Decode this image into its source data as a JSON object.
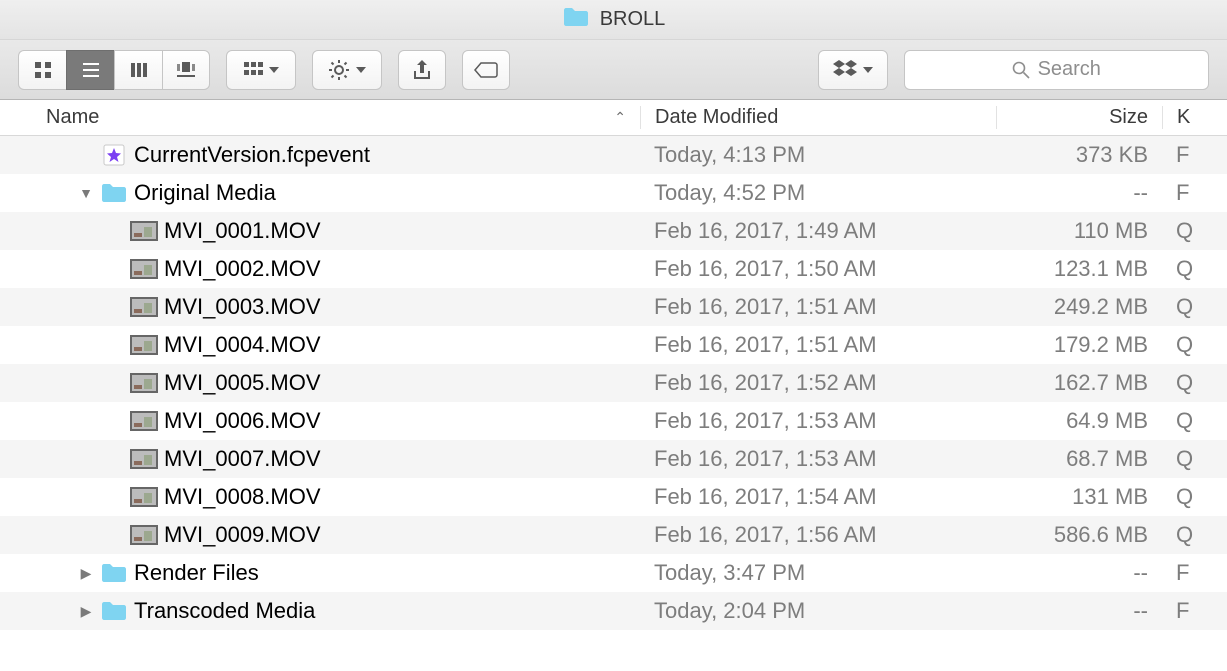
{
  "window": {
    "title": "BROLL"
  },
  "toolbar": {
    "search_placeholder": "Search",
    "view_modes": [
      "icon",
      "list",
      "column",
      "coverflow"
    ],
    "active_view_mode": "list"
  },
  "columns": {
    "name": "Name",
    "date": "Date Modified",
    "size": "Size",
    "kind": "K",
    "sort_column": "name",
    "sort_dir": "asc"
  },
  "rows": [
    {
      "indent": 1,
      "disclosure": "none",
      "icon": "fcp",
      "name": "CurrentVersion.fcpevent",
      "date": "Today, 4:13 PM",
      "size": "373 KB",
      "kind": "F"
    },
    {
      "indent": 1,
      "disclosure": "open",
      "icon": "folder",
      "name": "Original Media",
      "date": "Today, 4:52 PM",
      "size": "--",
      "kind": "F"
    },
    {
      "indent": 2,
      "disclosure": "none",
      "icon": "movie",
      "name": "MVI_0001.MOV",
      "date": "Feb 16, 2017, 1:49 AM",
      "size": "110 MB",
      "kind": "Q"
    },
    {
      "indent": 2,
      "disclosure": "none",
      "icon": "movie",
      "name": "MVI_0002.MOV",
      "date": "Feb 16, 2017, 1:50 AM",
      "size": "123.1 MB",
      "kind": "Q"
    },
    {
      "indent": 2,
      "disclosure": "none",
      "icon": "movie",
      "name": "MVI_0003.MOV",
      "date": "Feb 16, 2017, 1:51 AM",
      "size": "249.2 MB",
      "kind": "Q"
    },
    {
      "indent": 2,
      "disclosure": "none",
      "icon": "movie",
      "name": "MVI_0004.MOV",
      "date": "Feb 16, 2017, 1:51 AM",
      "size": "179.2 MB",
      "kind": "Q"
    },
    {
      "indent": 2,
      "disclosure": "none",
      "icon": "movie",
      "name": "MVI_0005.MOV",
      "date": "Feb 16, 2017, 1:52 AM",
      "size": "162.7 MB",
      "kind": "Q"
    },
    {
      "indent": 2,
      "disclosure": "none",
      "icon": "movie",
      "name": "MVI_0006.MOV",
      "date": "Feb 16, 2017, 1:53 AM",
      "size": "64.9 MB",
      "kind": "Q"
    },
    {
      "indent": 2,
      "disclosure": "none",
      "icon": "movie",
      "name": "MVI_0007.MOV",
      "date": "Feb 16, 2017, 1:53 AM",
      "size": "68.7 MB",
      "kind": "Q"
    },
    {
      "indent": 2,
      "disclosure": "none",
      "icon": "movie",
      "name": "MVI_0008.MOV",
      "date": "Feb 16, 2017, 1:54 AM",
      "size": "131 MB",
      "kind": "Q"
    },
    {
      "indent": 2,
      "disclosure": "none",
      "icon": "movie",
      "name": "MVI_0009.MOV",
      "date": "Feb 16, 2017, 1:56 AM",
      "size": "586.6 MB",
      "kind": "Q"
    },
    {
      "indent": 1,
      "disclosure": "closed",
      "icon": "folder",
      "name": "Render Files",
      "date": "Today, 3:47 PM",
      "size": "--",
      "kind": "F"
    },
    {
      "indent": 1,
      "disclosure": "closed",
      "icon": "folder",
      "name": "Transcoded Media",
      "date": "Today, 2:04 PM",
      "size": "--",
      "kind": "F"
    }
  ]
}
